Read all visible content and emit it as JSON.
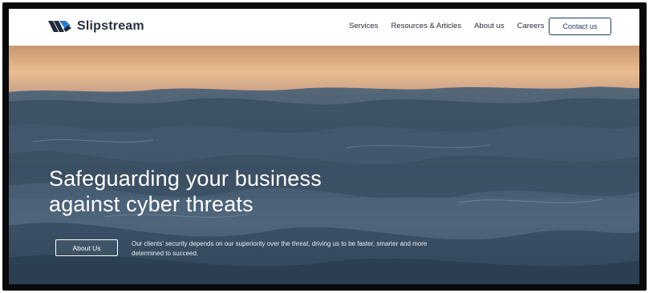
{
  "brand": {
    "name": "Slipstream",
    "logo_icon": "slipstream-logo-icon",
    "colors": {
      "primary": "#1f3a63",
      "accent": "#2a7bd6",
      "text": "#26303f"
    }
  },
  "nav": {
    "links": [
      {
        "label": "Services"
      },
      {
        "label": "Resources & Articles"
      },
      {
        "label": "About us"
      },
      {
        "label": "Careers"
      }
    ],
    "contact_label": "Contact us"
  },
  "hero": {
    "title_line1": "Safeguarding your business",
    "title_line2": "against cyber threats",
    "cta_label": "About Us",
    "description": "Our clients' security depends on our superiority over the threat, driving us to be faster, smarter and more determined to succeed.",
    "background": "ocean-waves-sunset"
  }
}
